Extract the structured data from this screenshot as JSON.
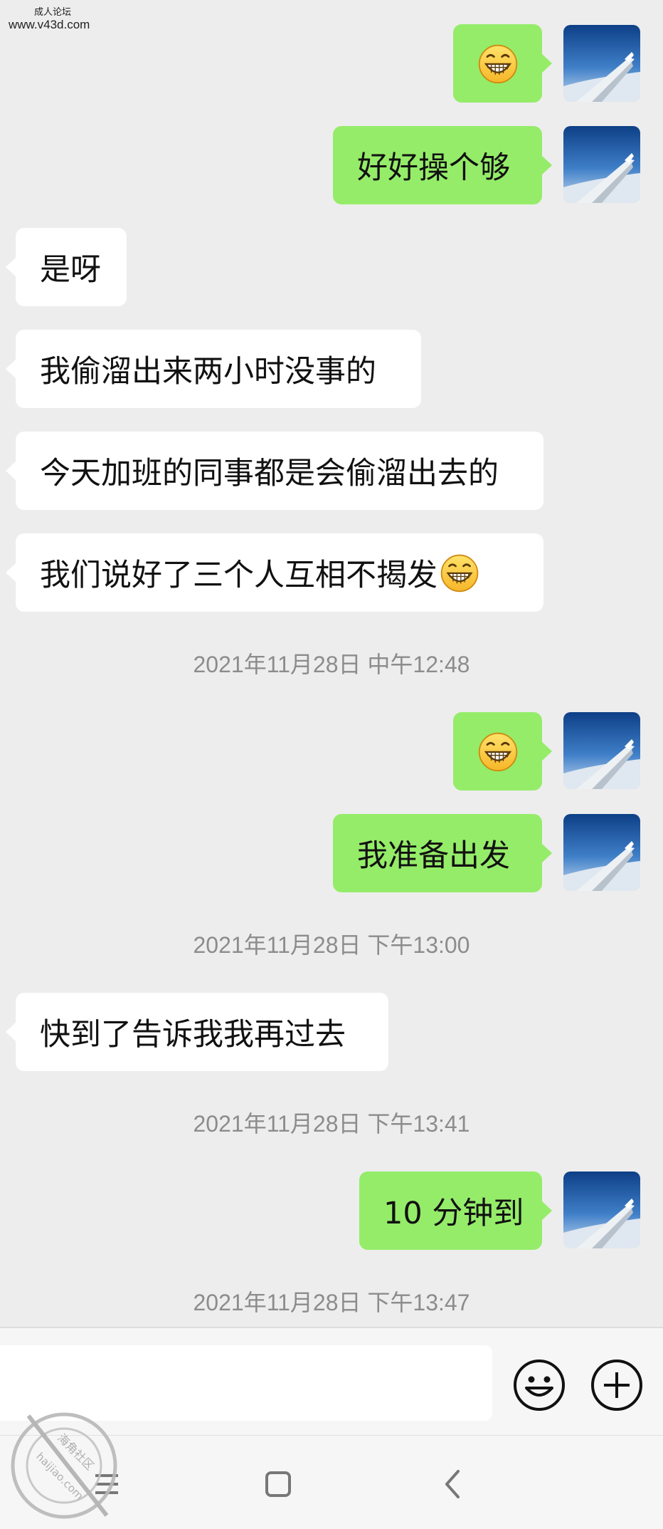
{
  "watermark": {
    "line1": "成人论坛",
    "line2": "www.v43d.com"
  },
  "messages": [
    {
      "id": "m1",
      "type": "emoji_out"
    },
    {
      "id": "m2",
      "text": "好好操个够"
    },
    {
      "id": "m3",
      "text": "是呀"
    },
    {
      "id": "m4",
      "text": "我偷溜出来两小时没事的"
    },
    {
      "id": "m5",
      "text": "今天加班的同事都是会偷溜出去的"
    },
    {
      "id": "m6",
      "text": "我们说好了三个人互相不揭发"
    },
    {
      "id": "t1",
      "text": "2021年11月28日 中午12:48"
    },
    {
      "id": "m7",
      "type": "emoji_out"
    },
    {
      "id": "m8",
      "text": "我准备出发"
    },
    {
      "id": "t2",
      "text": "2021年11月28日 下午13:00"
    },
    {
      "id": "m9",
      "text": "快到了告诉我我再过去"
    },
    {
      "id": "t3",
      "text": "2021年11月28日 下午13:41"
    },
    {
      "id": "m10",
      "text": "10 分钟到"
    },
    {
      "id": "t4",
      "text": "2021年11月28日 下午13:47"
    }
  ],
  "input": {
    "value": ""
  },
  "icons": {
    "emoji": "grinning-emoji-icon",
    "smiley_button": "smiley-face-icon",
    "plus_button": "plus-circle-icon",
    "nav_menu": "menu-icon",
    "nav_home": "home-square-icon",
    "nav_back": "back-chevron-icon"
  },
  "stamp": {
    "line1": "海角社区",
    "line2": "haijiao.com"
  },
  "colors": {
    "outgoing": "#95ec69",
    "incoming": "#ffffff",
    "background": "#ededed",
    "timestamp": "#8c8c8c"
  }
}
